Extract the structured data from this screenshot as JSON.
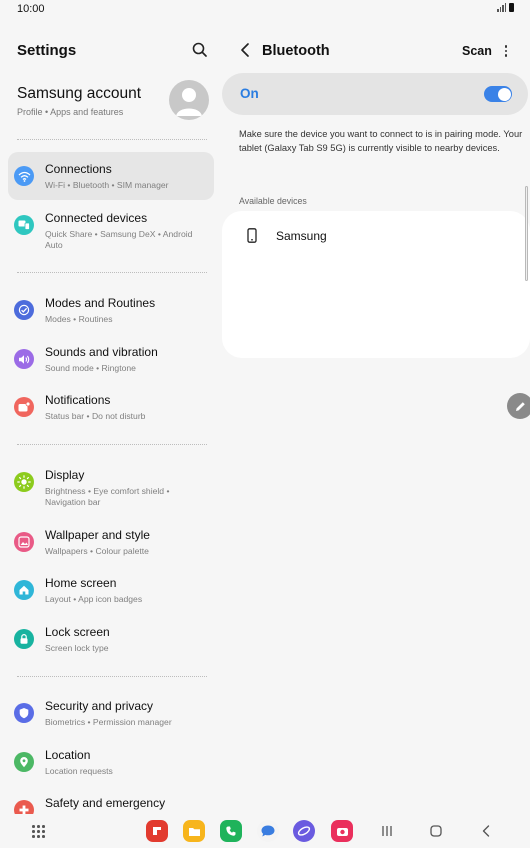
{
  "status": {
    "time": "10:00"
  },
  "settings": {
    "title": "Settings",
    "account": {
      "name": "Samsung account",
      "subtitle": "Profile  •  Apps and features"
    },
    "items": [
      {
        "title": "Connections",
        "subtitle": "Wi-Fi  •  Bluetooth  •  SIM manager",
        "icon": "wifi-icon",
        "color": "#4b9af5"
      },
      {
        "title": "Connected devices",
        "subtitle": "Quick Share  •  Samsung DeX  •  Android Auto",
        "icon": "connected-devices-icon",
        "color": "#2fc7c0"
      },
      {
        "title": "Modes and Routines",
        "subtitle": "Modes  •  Routines",
        "icon": "modes-icon",
        "color": "#4d6cdc"
      },
      {
        "title": "Sounds and vibration",
        "subtitle": "Sound mode  •  Ringtone",
        "icon": "speaker-icon",
        "color": "#9b6be6"
      },
      {
        "title": "Notifications",
        "subtitle": "Status bar  •  Do not disturb",
        "icon": "notifications-icon",
        "color": "#f0665e"
      },
      {
        "title": "Display",
        "subtitle": "Brightness  •  Eye comfort shield  •  Navigation bar",
        "icon": "sun-icon",
        "color": "#8ccb1d"
      },
      {
        "title": "Wallpaper and style",
        "subtitle": "Wallpapers  •  Colour palette",
        "icon": "wallpaper-icon",
        "color": "#e95a86"
      },
      {
        "title": "Home screen",
        "subtitle": "Layout  •  App icon badges",
        "icon": "home-icon",
        "color": "#2fb6d8"
      },
      {
        "title": "Lock screen",
        "subtitle": "Screen lock type",
        "icon": "lock-icon",
        "color": "#18b3a0"
      },
      {
        "title": "Security and privacy",
        "subtitle": "Biometrics  •  Permission manager",
        "icon": "shield-icon",
        "color": "#5a6de6"
      },
      {
        "title": "Location",
        "subtitle": "Location requests",
        "icon": "location-icon",
        "color": "#4cb865"
      },
      {
        "title": "Safety and emergency",
        "subtitle": "",
        "icon": "safety-icon",
        "color": "#ea5a4e"
      }
    ]
  },
  "bluetooth": {
    "title": "Bluetooth",
    "scan_label": "Scan",
    "toggle_label": "On",
    "toggle_on": true,
    "info": "Make sure the device you want to connect to is in pairing mode. Your tablet (Galaxy Tab S9 5G) is currently visible to nearby devices.",
    "available_header": "Available devices",
    "devices": [
      {
        "name": "Samsung",
        "icon": "phone-icon"
      }
    ]
  },
  "dock_apps": [
    {
      "icon": "flipboard-icon",
      "color": "#e23b2f"
    },
    {
      "icon": "my-files-icon",
      "color": "#f7b51c"
    },
    {
      "icon": "phone-app-icon",
      "color": "#1fb35b"
    },
    {
      "icon": "messages-icon",
      "color": "#3a7de0"
    },
    {
      "icon": "internet-icon",
      "color": "#6a5be0"
    },
    {
      "icon": "camera-icon",
      "color": "#ea2f5c"
    }
  ],
  "colors": {
    "accent": "#2a7de1",
    "card": "#e4e4e4",
    "background": "#f6f6f6"
  }
}
